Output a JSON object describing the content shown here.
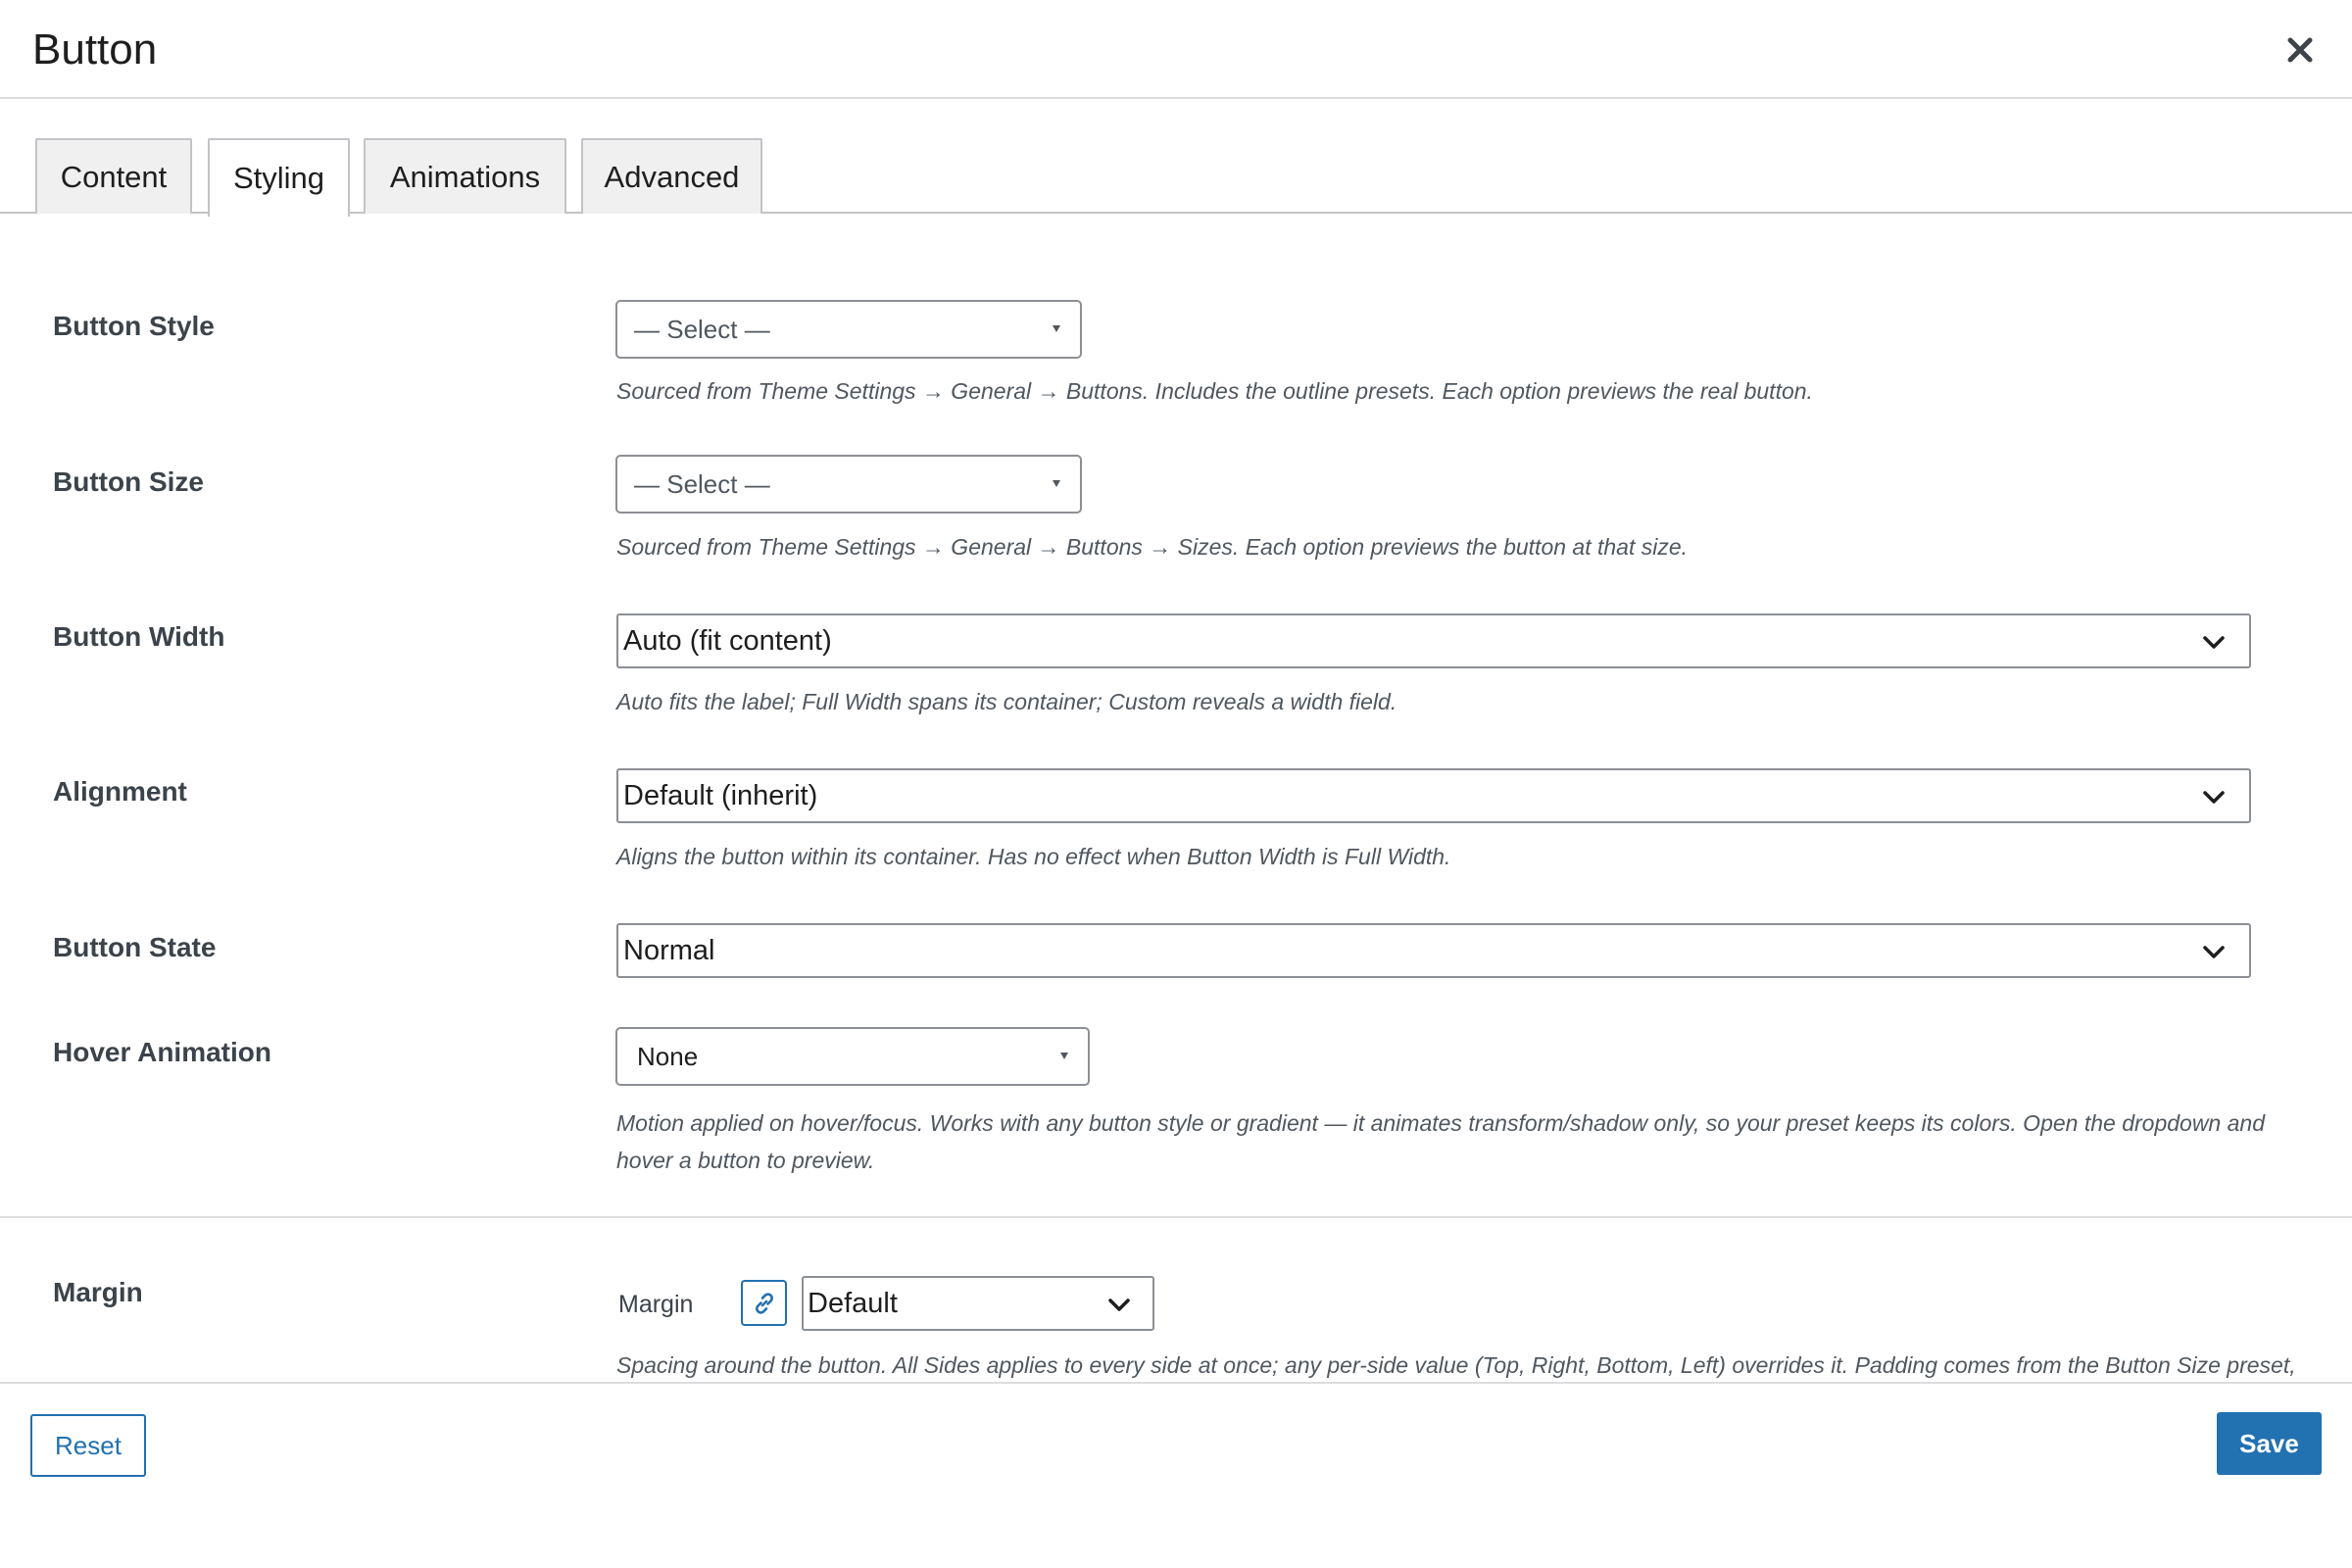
{
  "dialog": {
    "title": "Button"
  },
  "tabs": [
    {
      "label": "Content",
      "active": false
    },
    {
      "label": "Styling",
      "active": true
    },
    {
      "label": "Animations",
      "active": false
    },
    {
      "label": "Advanced",
      "active": false
    }
  ],
  "fields": {
    "button_style": {
      "label": "Button Style",
      "value": "— Select —",
      "help": "Sourced from Theme Settings → General → Buttons. Includes the outline presets. Each option previews the real button."
    },
    "button_size": {
      "label": "Button Size",
      "value": "— Select —",
      "help": "Sourced from Theme Settings → General → Buttons → Sizes. Each option previews the button at that size."
    },
    "button_width": {
      "label": "Button Width",
      "value": "Auto (fit content)",
      "help": "Auto fits the label; Full Width spans its container; Custom reveals a width field."
    },
    "alignment": {
      "label": "Alignment",
      "value": "Default (inherit)",
      "help": "Aligns the button within its container. Has no effect when Button Width is Full Width."
    },
    "button_state": {
      "label": "Button State",
      "value": "Normal"
    },
    "hover_animation": {
      "label": "Hover Animation",
      "value": "None",
      "help": "Motion applied on hover/focus. Works with any button style or gradient — it animates transform/shadow only, so your preset keeps its colors. Open the dropdown and hover a button to preview."
    },
    "margin": {
      "label": "Margin",
      "sublabel": "Margin",
      "value": "Default",
      "help": "Spacing around the button. All Sides applies to every side at once; any per-side value (Top, Right, Bottom, Left) overrides it. Padding comes from the Button Size preset,"
    }
  },
  "footer": {
    "reset_label": "Reset",
    "save_label": "Save"
  },
  "colors": {
    "accent": "#2271b1",
    "border": "#8c8f94",
    "help_text": "#50575e",
    "label_text": "#3c434a"
  },
  "icons": {
    "close": "close-icon",
    "link": "link-icon",
    "chevron": "chevron-down-icon"
  }
}
